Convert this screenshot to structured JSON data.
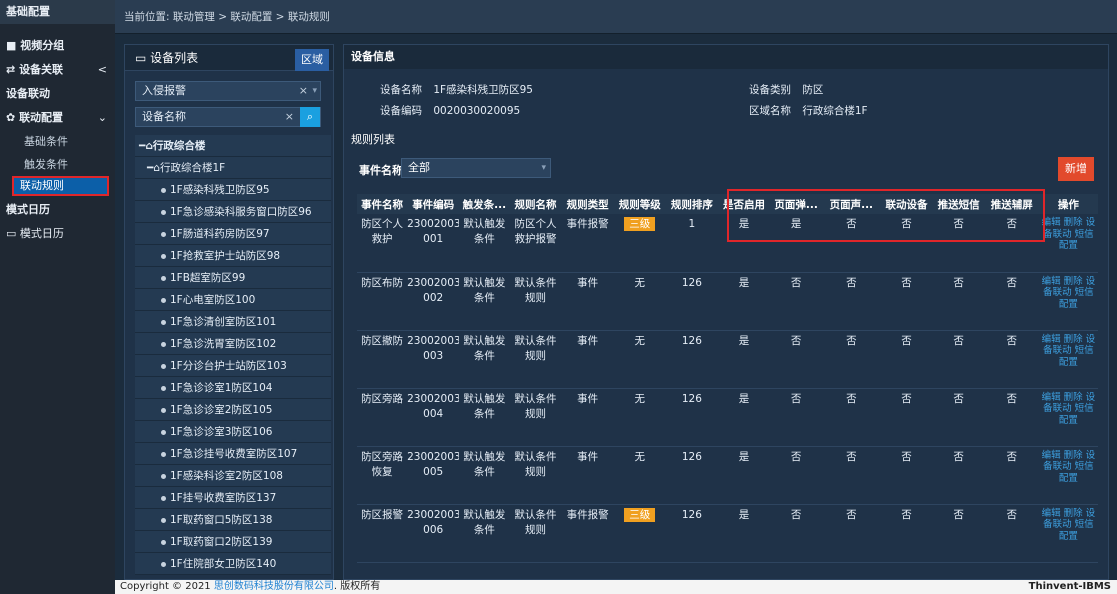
{
  "sidebar": {
    "header": "基础配置",
    "items": [
      {
        "label": "视频分组",
        "icon": "video-icon"
      },
      {
        "label": "设备关联",
        "icon": "link-icon",
        "arrow": "<"
      },
      {
        "label": "设备联动"
      },
      {
        "label": "联动配置",
        "icon": "gear-icon",
        "arrow": "⌄"
      }
    ],
    "sub": [
      "基础条件",
      "触发条件",
      "联动规则"
    ],
    "items2": [
      {
        "label": "模式日历"
      },
      {
        "label": "模式日历",
        "icon": "monitor-icon"
      }
    ]
  },
  "breadcrumb": "当前位置: 联动管理 > 联动配置 > 联动规则",
  "device_panel": {
    "title": "设备列表",
    "area_button": "区域",
    "filter_value": "入侵报警",
    "search_placeholder": "设备名称",
    "tree": [
      {
        "label": "行政综合楼",
        "level": 0
      },
      {
        "label": "行政综合楼1F",
        "level": 1
      },
      {
        "label": "1F感染科残卫防区95",
        "level": 2
      },
      {
        "label": "1F急诊感染科服务窗口防区96",
        "level": 2
      },
      {
        "label": "1F肠道科药房防区97",
        "level": 2
      },
      {
        "label": "1F抢救室护士站防区98",
        "level": 2
      },
      {
        "label": "1FB超室防区99",
        "level": 2
      },
      {
        "label": "1F心电室防区100",
        "level": 2
      },
      {
        "label": "1F急诊清创室防区101",
        "level": 2
      },
      {
        "label": "1F急诊洗胃室防区102",
        "level": 2
      },
      {
        "label": "1F分诊台护士站防区103",
        "level": 2
      },
      {
        "label": "1F急诊诊室1防区104",
        "level": 2
      },
      {
        "label": "1F急诊诊室2防区105",
        "level": 2
      },
      {
        "label": "1F急诊诊室3防区106",
        "level": 2
      },
      {
        "label": "1F急诊挂号收费室防区107",
        "level": 2
      },
      {
        "label": "1F感染科诊室2防区108",
        "level": 2
      },
      {
        "label": "1F挂号收费室防区137",
        "level": 2
      },
      {
        "label": "1F取药窗口5防区138",
        "level": 2
      },
      {
        "label": "1F取药窗口2防区139",
        "level": 2
      },
      {
        "label": "1F住院部女卫防区140",
        "level": 2
      }
    ]
  },
  "device_info": {
    "title": "设备信息",
    "name_label": "设备名称",
    "name_value": "1F感染科残卫防区95",
    "type_label": "设备类别",
    "type_value": "防区",
    "code_label": "设备编码",
    "code_value": "0020030020095",
    "area_label": "区域名称",
    "area_value": "行政综合楼1F"
  },
  "rules": {
    "title": "规则列表",
    "event_label": "事件名称",
    "event_value": "全部",
    "add_button": "新增",
    "columns": [
      "事件名称",
      "事件编码",
      "触发条...",
      "规则名称",
      "规则类型",
      "规则等级",
      "规则排序",
      "是否启用",
      "页面弹...",
      "页面声...",
      "联动设备",
      "推送短信",
      "推送辅屏",
      "操作"
    ],
    "rows": [
      [
        "防区个人救护",
        "23002003 001",
        "默认触发条件",
        "防区个人救护报警",
        "事件报警",
        "三级",
        "1",
        "是",
        "是",
        "否",
        "否",
        "否",
        "否",
        "编辑 删除 设备联动 短信配置"
      ],
      [
        "防区布防",
        "23002003 002",
        "默认触发条件",
        "默认条件规则",
        "事件",
        "无",
        "126",
        "是",
        "否",
        "否",
        "否",
        "否",
        "否",
        "编辑 删除 设备联动 短信配置"
      ],
      [
        "防区撤防",
        "23002003 003",
        "默认触发条件",
        "默认条件规则",
        "事件",
        "无",
        "126",
        "是",
        "否",
        "否",
        "否",
        "否",
        "否",
        "编辑 删除 设备联动 短信配置"
      ],
      [
        "防区旁路",
        "23002003 004",
        "默认触发条件",
        "默认条件规则",
        "事件",
        "无",
        "126",
        "是",
        "否",
        "否",
        "否",
        "否",
        "否",
        "编辑 删除 设备联动 短信配置"
      ],
      [
        "防区旁路恢复",
        "23002003 005",
        "默认触发条件",
        "默认条件规则",
        "事件",
        "无",
        "126",
        "是",
        "否",
        "否",
        "否",
        "否",
        "否",
        "编辑 删除 设备联动 短信配置"
      ],
      [
        "防区报警",
        "23002003 006",
        "默认触发条件",
        "默认条件规则",
        "事件报警",
        "三级",
        "126",
        "是",
        "否",
        "否",
        "否",
        "否",
        "否",
        "编辑 删除 设备联动 短信配置"
      ]
    ]
  },
  "footer": {
    "copyright": "Copyright © 2021 ",
    "company": "思创数码科技股份有限公司",
    "rights": ". 版权所有",
    "product": "Thinvent-IBMS"
  },
  "colors": {
    "highlight": "#e0262a",
    "accent": "#1aa0e0",
    "badge": "#f0a020",
    "add": "#e24a2c"
  }
}
